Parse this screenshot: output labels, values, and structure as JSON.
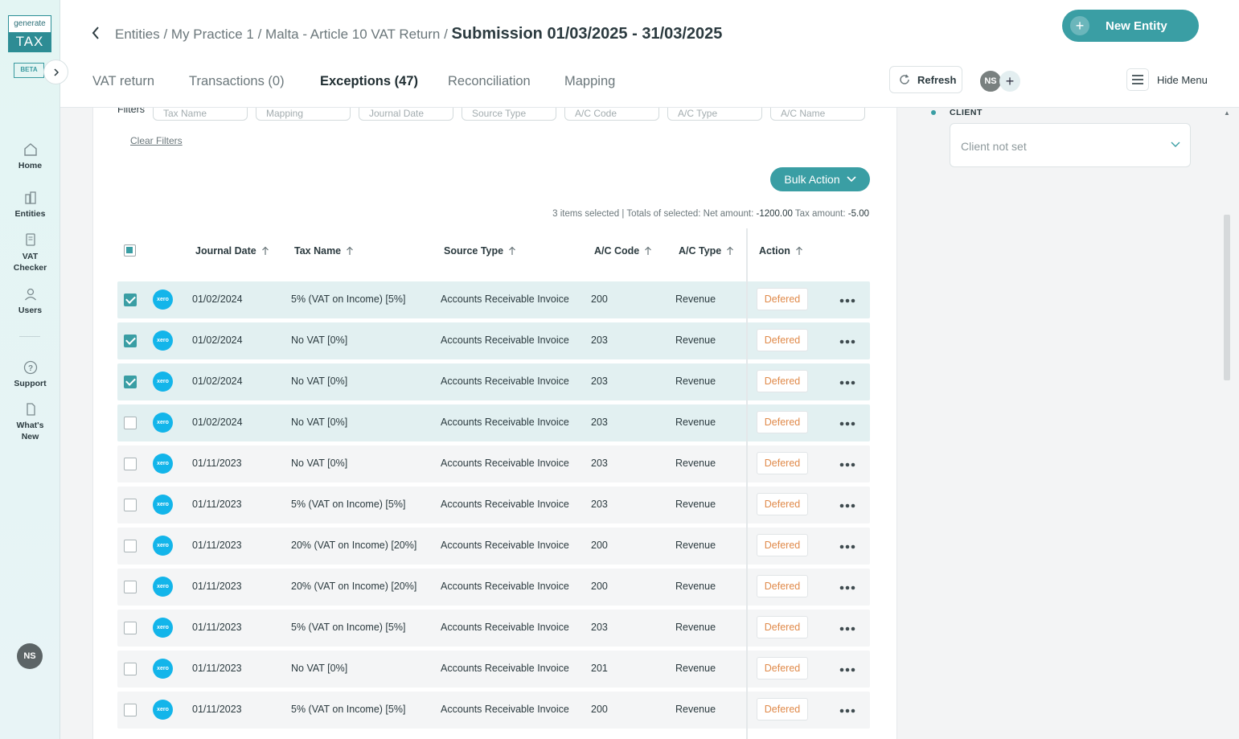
{
  "brand": {
    "logo_top": "generate",
    "logo_bottom": "TAX",
    "badge": "BETA"
  },
  "nav": {
    "items": [
      {
        "label": "Home",
        "icon": "home-icon"
      },
      {
        "label": "Entities",
        "icon": "building-icon"
      },
      {
        "label": "VAT Checker",
        "icon": "document-icon"
      },
      {
        "label": "Users",
        "icon": "user-icon"
      },
      {
        "label": "Support",
        "icon": "help-icon"
      },
      {
        "label": "What's New",
        "icon": "news-icon"
      }
    ],
    "avatar_initials": "NS"
  },
  "header": {
    "breadcrumb": "Entities / My Practice 1 / Malta - Article 10 VAT Return /",
    "current": "Submission 01/03/2025 - 31/03/2025",
    "new_entity_label": "New Entity",
    "tabs": [
      "VAT return",
      "Transactions (0)",
      "Exceptions (47)",
      "Reconciliation",
      "Mapping"
    ],
    "active_tab": "Exceptions (47)",
    "refresh_label": "Refresh",
    "avatar_initials": "NS",
    "hide_menu_label": "Hide Menu"
  },
  "filters": {
    "label": "Filters",
    "items": [
      "Tax Name",
      "Mapping",
      "Journal Date",
      "Source Type",
      "A/C Code",
      "A/C Type",
      "A/C Name"
    ],
    "clear_label": "Clear Filters"
  },
  "bulk_action_label": "Bulk Action",
  "selection": {
    "items_selected": "3 items selected",
    "separator": "|",
    "totals_label": "Totals of selected: Net amount:",
    "net_amount": "-1200.00",
    "tax_label": "Tax amount:",
    "tax_amount": "-5.00"
  },
  "table": {
    "columns": [
      "Journal Date",
      "Tax Name",
      "Source Type",
      "A/C Code",
      "A/C Type",
      "Action"
    ],
    "source_badge": "xero",
    "rows": [
      {
        "selected": true,
        "date": "01/02/2024",
        "tax": "5% (VAT on Income) [5%]",
        "source": "Accounts Receivable Invoice",
        "code": "200",
        "type": "Revenue",
        "status": "Defered"
      },
      {
        "selected": true,
        "date": "01/02/2024",
        "tax": "No VAT [0%]",
        "source": "Accounts Receivable Invoice",
        "code": "203",
        "type": "Revenue",
        "status": "Defered"
      },
      {
        "selected": true,
        "date": "01/02/2024",
        "tax": "No VAT [0%]",
        "source": "Accounts Receivable Invoice",
        "code": "203",
        "type": "Revenue",
        "status": "Defered"
      },
      {
        "selected": false,
        "highlight": true,
        "date": "01/02/2024",
        "tax": "No VAT [0%]",
        "source": "Accounts Receivable Invoice",
        "code": "203",
        "type": "Revenue",
        "status": "Defered"
      },
      {
        "selected": false,
        "date": "01/11/2023",
        "tax": "No VAT [0%]",
        "source": "Accounts Receivable Invoice",
        "code": "203",
        "type": "Revenue",
        "status": "Defered"
      },
      {
        "selected": false,
        "date": "01/11/2023",
        "tax": "5% (VAT on Income) [5%]",
        "source": "Accounts Receivable Invoice",
        "code": "203",
        "type": "Revenue",
        "status": "Defered"
      },
      {
        "selected": false,
        "date": "01/11/2023",
        "tax": "20% (VAT on Income) [20%]",
        "source": "Accounts Receivable Invoice",
        "code": "200",
        "type": "Revenue",
        "status": "Defered"
      },
      {
        "selected": false,
        "date": "01/11/2023",
        "tax": "20% (VAT on Income) [20%]",
        "source": "Accounts Receivable Invoice",
        "code": "200",
        "type": "Revenue",
        "status": "Defered"
      },
      {
        "selected": false,
        "date": "01/11/2023",
        "tax": "5% (VAT on Income) [5%]",
        "source": "Accounts Receivable Invoice",
        "code": "203",
        "type": "Revenue",
        "status": "Defered"
      },
      {
        "selected": false,
        "date": "01/11/2023",
        "tax": "No VAT [0%]",
        "source": "Accounts Receivable Invoice",
        "code": "201",
        "type": "Revenue",
        "status": "Defered"
      },
      {
        "selected": false,
        "date": "01/11/2023",
        "tax": "5% (VAT on Income) [5%]",
        "source": "Accounts Receivable Invoice",
        "code": "200",
        "type": "Revenue",
        "status": "Defered"
      }
    ]
  },
  "client_panel": {
    "label": "CLIENT",
    "placeholder": "Client not set"
  },
  "colors": {
    "accent": "#3a9ea4",
    "status": "#e08a4a",
    "xero": "#13b5ea"
  }
}
